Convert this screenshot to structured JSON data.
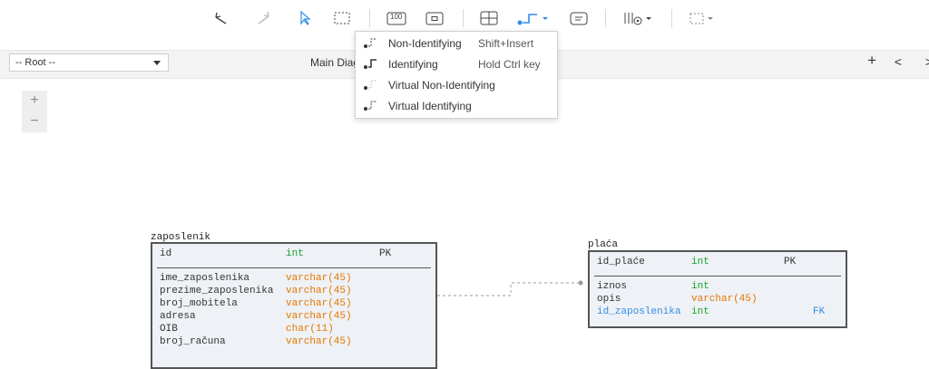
{
  "toolbar": {
    "zoom_label": "100",
    "buttons": [
      "undo-icon",
      "redo-icon",
      "pointer-icon",
      "select-area-icon",
      "zoom-100-icon",
      "fit-icon",
      "table-icon",
      "relationship-icon",
      "note-icon",
      "visibility-icon",
      "layout-icon"
    ]
  },
  "subbar": {
    "root_select": "-- Root --",
    "diagram_title": "Main Diagram",
    "add": "+",
    "prev": "<",
    "next": ">"
  },
  "zoom_controls": {
    "in": "+",
    "out": "−"
  },
  "relationship_menu": {
    "items": [
      {
        "label": "Non-Identifying",
        "shortcut": "Shift+Insert",
        "icon": "non-identifying-icon"
      },
      {
        "label": "Identifying",
        "shortcut": "Hold Ctrl key",
        "icon": "identifying-icon"
      },
      {
        "label": "Virtual Non-Identifying",
        "shortcut": "",
        "icon": "virtual-non-identifying-icon"
      },
      {
        "label": "Virtual Identifying",
        "shortcut": "",
        "icon": "virtual-identifying-icon"
      }
    ]
  },
  "tables": {
    "zaposlenik": {
      "name": "zaposlenik",
      "pk": {
        "name": "id",
        "type": "int",
        "key": "PK"
      },
      "columns": [
        {
          "name": "ime_zaposlenika",
          "type": "varchar(45)"
        },
        {
          "name": "prezime_zaposlenika",
          "type": "varchar(45)"
        },
        {
          "name": "broj_mobitela",
          "type": "varchar(45)"
        },
        {
          "name": "adresa",
          "type": "varchar(45)"
        },
        {
          "name": "OIB",
          "type": "char(11)"
        },
        {
          "name": "broj_računa",
          "type": "varchar(45)"
        }
      ]
    },
    "placa": {
      "name": "plaća",
      "pk": {
        "name": "id_plaće",
        "type": "int",
        "key": "PK"
      },
      "columns": [
        {
          "name": "iznos",
          "type": "int",
          "key": ""
        },
        {
          "name": "opis",
          "type": "varchar(45)",
          "key": ""
        },
        {
          "name": "id_zaposlenika",
          "type": "int",
          "key": "FK"
        }
      ]
    }
  },
  "colors": {
    "int": "#13a32a",
    "varchar": "#e67700",
    "fk": "#2f8ee8",
    "accent": "#2f8ee8"
  }
}
